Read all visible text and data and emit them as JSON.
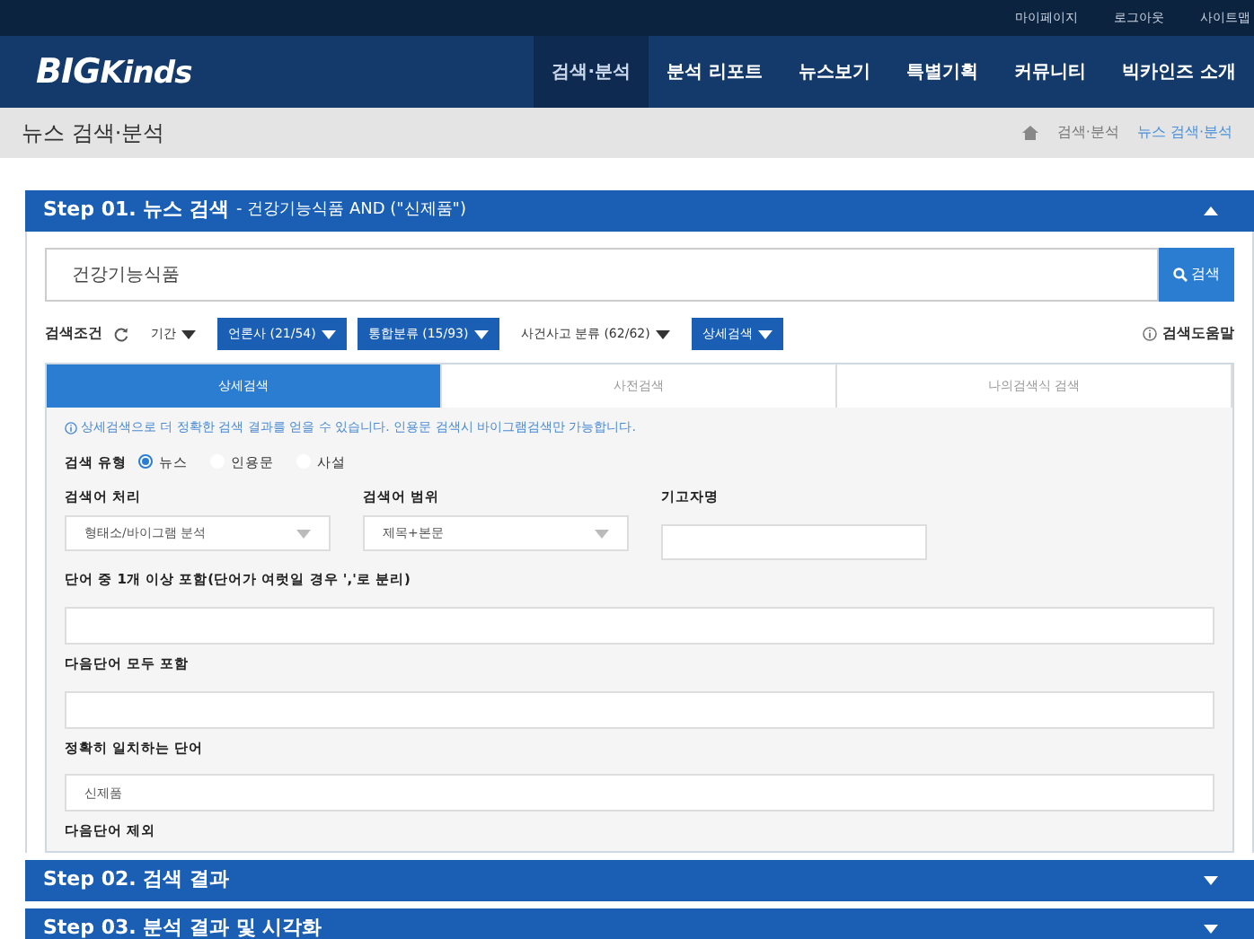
{
  "top_links": [
    "마이페이지",
    "로그아웃",
    "사이트맵"
  ],
  "logo": {
    "main": "BIG",
    "accent": "Kinds"
  },
  "nav": [
    {
      "label": "검색·분석",
      "selected": true
    },
    {
      "label": "분석 리포트",
      "selected": false
    },
    {
      "label": "뉴스보기",
      "selected": false
    },
    {
      "label": "특별기획",
      "selected": false
    },
    {
      "label": "커뮤니티",
      "selected": false
    },
    {
      "label": "빅카인즈 소개",
      "selected": false
    }
  ],
  "page_title": "뉴스 검색·분석",
  "breadcrumb": [
    {
      "label": "검색·분석",
      "current": false
    },
    {
      "label": "뉴스 검색·분석",
      "current": true
    }
  ],
  "step1": {
    "title": "Step 01. 뉴스 검색",
    "query": "- 건강기능식품 AND (\"신제품\")",
    "expanded": true,
    "search_value": "건강기능식품",
    "search_button": "검색",
    "conditions_label": "검색조건",
    "filters": [
      {
        "label": "기간",
        "active": false
      },
      {
        "label": "언론사 (21/54)",
        "active": true
      },
      {
        "label": "통합분류 (15/93)",
        "active": true
      },
      {
        "label": "사건사고 분류 (62/62)",
        "active": false
      },
      {
        "label": "상세검색",
        "active": true
      }
    ],
    "help": "검색도움말",
    "tabs": [
      {
        "label": "상세검색",
        "selected": true
      },
      {
        "label": "사전검색",
        "selected": false
      },
      {
        "label": "나의검색식 검색",
        "selected": false
      }
    ],
    "hint": "상세검색으로 더 정확한 검색 결과를 얻을 수 있습니다. 인용문 검색시 바이그램검색만 가능합니다.",
    "search_type": {
      "label": "검색 유형",
      "options": [
        {
          "label": "뉴스",
          "selected": true
        },
        {
          "label": "인용문",
          "selected": false
        },
        {
          "label": "사설",
          "selected": false
        }
      ]
    },
    "selects": [
      {
        "label": "검색어 처리",
        "value": "형태소/바이그램 분석",
        "kind": "select"
      },
      {
        "label": "검색어 범위",
        "value": "제목+본문",
        "kind": "select"
      },
      {
        "label": "기고자명",
        "kind": "input"
      }
    ],
    "text_fields": [
      {
        "label": "단어 중 1개 이상 포함(단어가 여럿일 경우 ','로 분리)",
        "kind": "field"
      },
      {
        "label": "다음단어 모두 포함",
        "kind": "field"
      },
      {
        "label": "정확히 일치하는 단어",
        "value": "신제품",
        "kind": "field"
      },
      {
        "label": "다음단어 제외",
        "kind": "label"
      }
    ]
  },
  "steps": [
    {
      "title": "Step 02. 검색 결과",
      "expanded": false
    },
    {
      "title": "Step 03. 분석 결과 및 시각화",
      "expanded": false
    }
  ]
}
